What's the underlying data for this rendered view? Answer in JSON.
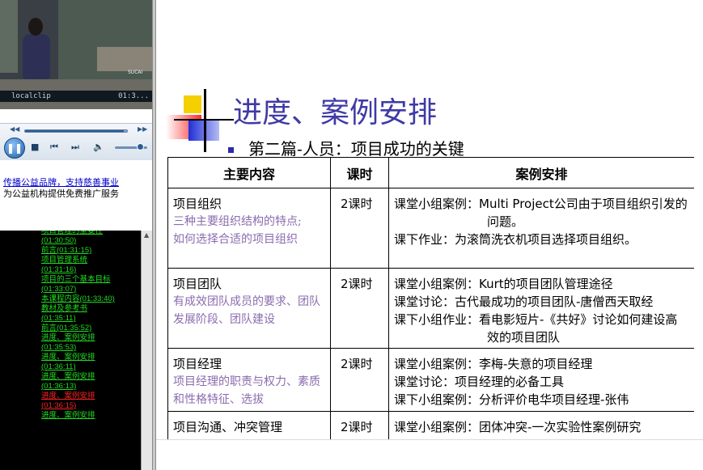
{
  "video": {
    "clip_name": "localclip",
    "time": "01:3...",
    "logo": "SUCAI"
  },
  "player": {
    "seek_fraction": 0.97,
    "volume_fraction": 0.78,
    "icons": {
      "seek_back": "rewind-icon",
      "seek_forward": "fast-forward-icon",
      "play_pause": "pause-icon",
      "stop": "stop-icon",
      "prev": "previous-icon",
      "next": "next-icon",
      "volume": "speaker-icon"
    }
  },
  "promo": {
    "link": "传播公益品牌，支持慈善事业",
    "text": "为公益机构提供免费推广服务"
  },
  "chapters": [
    {
      "lines": [
        "项目管理的重要性",
        "(01:30:50)"
      ],
      "current": false
    },
    {
      "lines": [
        "前言(01:31:15)"
      ],
      "current": false
    },
    {
      "lines": [
        "项目管理系统",
        "(01:31:16)"
      ],
      "current": false
    },
    {
      "lines": [
        "项目的三个基本目标",
        "(01:33:07)"
      ],
      "current": false
    },
    {
      "lines": [
        "本课程内容(01:33:40)"
      ],
      "current": false
    },
    {
      "lines": [
        "教材及参考书",
        "(01:35:11)"
      ],
      "current": false
    },
    {
      "lines": [
        "前言(01:35:52)"
      ],
      "current": false
    },
    {
      "lines": [
        "进度、案例安排",
        "(01:35:53)"
      ],
      "current": false
    },
    {
      "lines": [
        "进度、案例安排",
        "(01:36:11)"
      ],
      "current": false
    },
    {
      "lines": [
        "进度、案例安排",
        "(01:36:13)"
      ],
      "current": false
    },
    {
      "lines": [
        "进度、案例安排",
        "(01:36:15)"
      ],
      "current": true
    },
    {
      "lines": [
        "进度、案例安排"
      ],
      "current": false
    }
  ],
  "slide": {
    "title": "进度、案例安排",
    "subtitle": "第二篇-人员：项目成功的关键",
    "table": {
      "headers": [
        "主要内容",
        "课时",
        "案例安排"
      ],
      "rows": [
        {
          "topic": "项目组织",
          "desc": [
            "三种主要组织结构的特点;",
            "如何选择合适的项目组织"
          ],
          "hours": "2课时",
          "cases": [
            "课堂小组案例：Multi Project公司由于项目组织引发的问题。",
            "课下作业：为滚筒洗衣机项目选择项目组织。"
          ]
        },
        {
          "topic": "项目团队",
          "desc": [
            "有成效团队成员的要求、团队发展阶段、团队建设"
          ],
          "hours": "2课时",
          "cases": [
            "课堂小组案例：Kurt的项目团队管理途径",
            "课堂讨论：古代最成功的项目团队-唐僧西天取经",
            "课下小组作业：看电影短片-《共好》讨论如何建设高效的项目团队"
          ]
        },
        {
          "topic": "项目经理",
          "desc": [
            "项目经理的职责与权力、素质和性格特征、选拔"
          ],
          "hours": "2课时",
          "cases": [
            "课堂小组案例：李梅-失意的项目经理",
            "课堂讨论：项目经理的必备工具",
            "课下小组案例：分析评价电华项目经理-张伟"
          ]
        },
        {
          "topic": "项目沟通、冲突管理",
          "desc": [],
          "hours": "2课时",
          "cases": [
            "课堂小组案例：团体冲突-一次实验性案例研究"
          ]
        }
      ]
    }
  }
}
